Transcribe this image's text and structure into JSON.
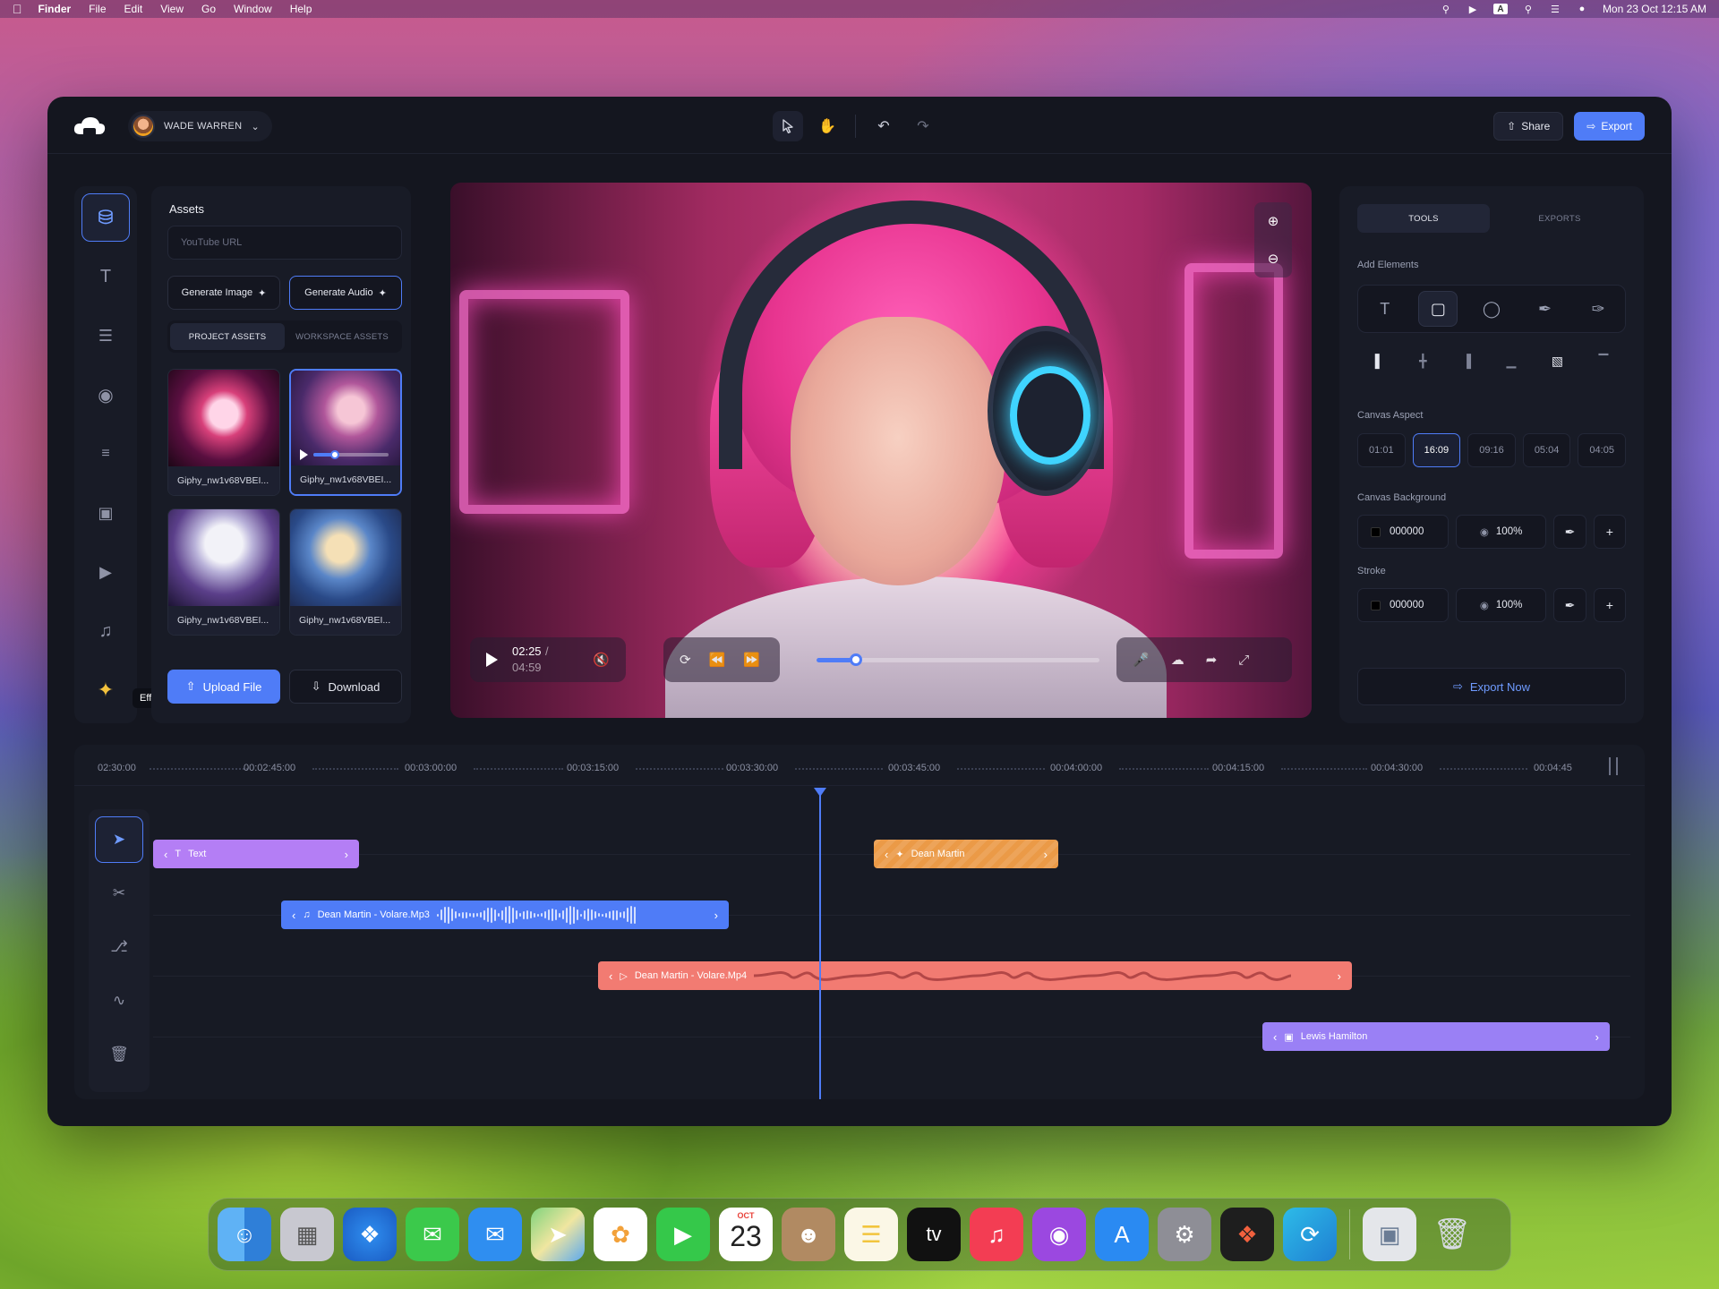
{
  "menubar": {
    "app": "Finder",
    "items": [
      "File",
      "Edit",
      "View",
      "Go",
      "Window",
      "Help"
    ],
    "datetime": "Mon 23 Oct  12:15 AM",
    "keyboard_badge": "A"
  },
  "header": {
    "user_name": "WADE WARREN",
    "share_label": "Share",
    "export_label": "Export"
  },
  "rail": {
    "items": [
      "assets-icon",
      "text-icon",
      "list-icon",
      "record-icon",
      "settings-icon",
      "image-icon",
      "video-icon",
      "music-icon",
      "effects-icon"
    ],
    "tooltip": "Effects"
  },
  "assets": {
    "title": "Assets",
    "url_placeholder": "YouTube URL",
    "generate_image": "Generate Image",
    "generate_audio": "Generate Audio",
    "tabs": [
      "PROJECT ASSETS",
      "WORKSPACE ASSETS"
    ],
    "thumbs": [
      {
        "caption": "Giphy_nw1v68VBEI..."
      },
      {
        "caption": "Giphy_nw1v68VBEI..."
      },
      {
        "caption": "Giphy_nw1v68VBEI..."
      },
      {
        "caption": "Giphy_nw1v68VBEI..."
      }
    ],
    "mini_progress": 0.28,
    "upload_label": "Upload File",
    "download_label": "Download"
  },
  "preview": {
    "time_current": "02:25",
    "time_separator": "/",
    "time_total": "04:59",
    "progress": 0.14
  },
  "right_panel": {
    "tabs": [
      "TOOLS",
      "EXPORTS"
    ],
    "add_elements_label": "Add Elements",
    "canvas_aspect_label": "Canvas Aspect",
    "aspects": [
      "01:01",
      "16:09",
      "09:16",
      "05:04",
      "04:05"
    ],
    "selected_aspect": "16:09",
    "canvas_background_label": "Canvas Background",
    "canvas_background": {
      "hex": "000000",
      "opacity": "100%"
    },
    "stroke_label": "Stroke",
    "stroke": {
      "hex": "000000",
      "opacity": "100%"
    },
    "export_now": "Export Now"
  },
  "timeline": {
    "ticks": [
      "02:30:00",
      "00:02:45:00",
      "00:03:00:00",
      "00:03:15:00",
      "00:03:30:00",
      "00:03:45:00",
      "00:04:00:00",
      "00:04:15:00",
      "00:04:30:00",
      "00:04:45"
    ],
    "clips": {
      "text": "Text",
      "dean": "Dean Martin",
      "audio": "Dean Martin - Volare.Mp3",
      "video": "Dean Martin - Volare.Mp4",
      "image": "Lewis Hamilton"
    }
  },
  "dock": {
    "calendar_month": "OCT",
    "calendar_day": "23",
    "tv_label": "tv"
  },
  "colors": {
    "accent": "#4f7cf7",
    "text_clip": "#b47ef5",
    "dean_clip": "#eb9a47",
    "video_clip": "#f27b72",
    "image_clip": "#9a80f5"
  }
}
